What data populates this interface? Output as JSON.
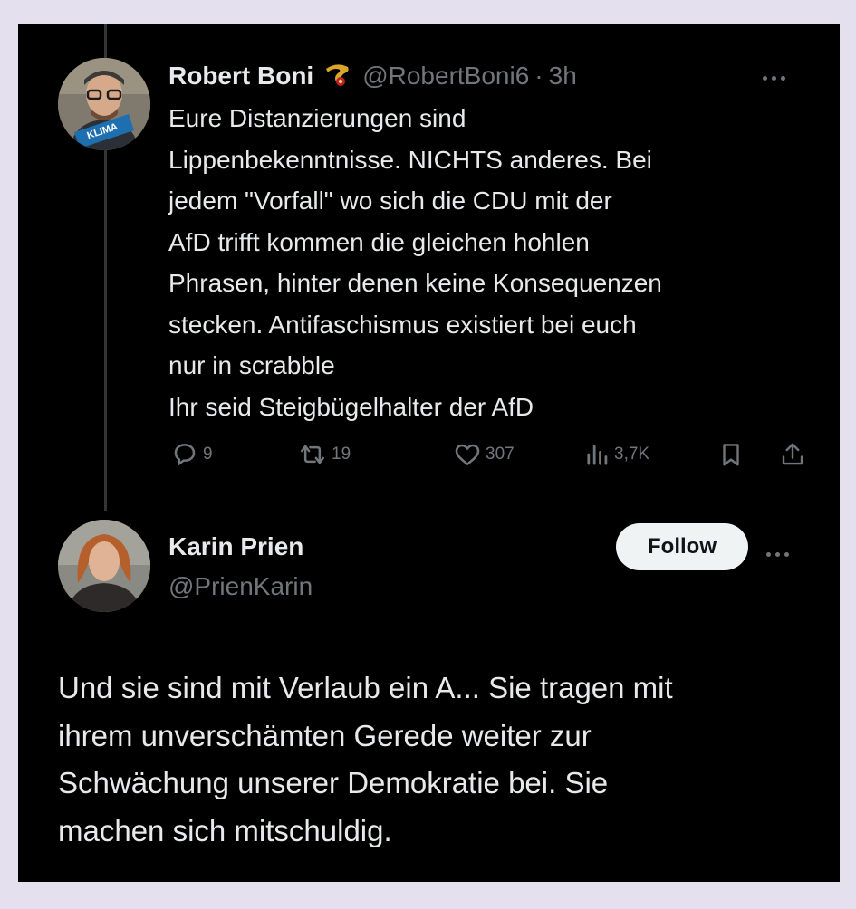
{
  "reply_parent": {
    "author_name": "Robert Boni",
    "handle": "@RobertBoni6",
    "separator": "·",
    "time": "3h",
    "avatar_badge": "KLIMA",
    "body_lines": [
      "Eure Distanzierungen sind",
      "Lippenbekenntnisse. NICHTS anderes. Bei",
      "jedem \"Vorfall\" wo sich die CDU mit der",
      "AfD trifft kommen die gleichen hohlen",
      "Phrasen, hinter denen keine Konsequenzen",
      "stecken. Antifaschismus existiert bei euch",
      "nur in scrabble",
      "Ihr seid Steigbügelhalter der AfD"
    ],
    "stats": {
      "replies": "9",
      "reposts": "19",
      "likes": "307",
      "views": "3,7K"
    }
  },
  "reply": {
    "author_name": "Karin Prien",
    "handle": "@PrienKarin",
    "follow_label": "Follow",
    "body_lines": [
      "Und sie sind mit Verlaub ein A... Sie tragen mit",
      "ihrem unverschämten Gerede weiter zur",
      "Schwächung unserer Demokratie bei. Sie",
      "machen sich mitschuldig."
    ]
  },
  "colors": {
    "background": "#000000",
    "text": "#e7e9ea",
    "muted": "#71767b",
    "follow_button": "#eff3f4",
    "outer_frame": "#e5e0ee"
  }
}
